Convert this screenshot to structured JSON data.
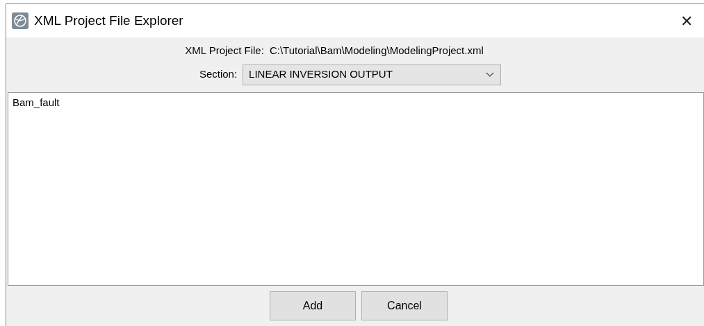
{
  "window": {
    "title": "XML Project File Explorer",
    "close": "✕"
  },
  "file_label": "XML Project File:",
  "file_path": "C:\\Tutorial\\Bam\\Modeling\\ModelingProject.xml",
  "section": {
    "label": "Section:",
    "value": "LINEAR INVERSION OUTPUT"
  },
  "items": [
    {
      "label": "Bam_fault",
      "selected": false
    }
  ],
  "buttons": [
    "Add",
    "Cancel"
  ]
}
